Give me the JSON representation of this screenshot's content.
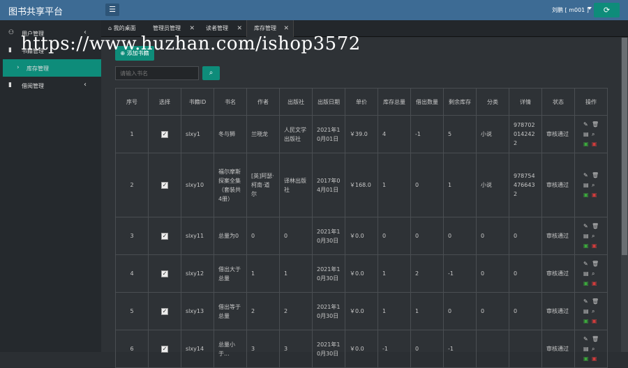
{
  "app": {
    "title": "图书共享平台",
    "user": "刘鹏 [ m001 ]"
  },
  "sidebar": {
    "items": [
      {
        "label": "用户管理",
        "icon": "user-icon"
      },
      {
        "label": "书籍管理",
        "icon": "book-icon"
      },
      {
        "label": "库存管理",
        "icon": "chevron-right-icon"
      },
      {
        "label": "借阅管理",
        "icon": "book-icon"
      }
    ]
  },
  "tabs": [
    {
      "label": "我的桌面"
    },
    {
      "label": "管理员管理"
    },
    {
      "label": "读者管理"
    },
    {
      "label": "库存管理"
    }
  ],
  "toolbar": {
    "add_label": "添加书籍",
    "search_placeholder": "请输入书名"
  },
  "watermark": "https://www.huzhan.com/ishop3572",
  "table": {
    "headers": [
      "序号",
      "选择",
      "书籍ID",
      "书名",
      "作者",
      "出版社",
      "出版日期",
      "单价",
      "库存总量",
      "借出数量",
      "剩余库存",
      "分类",
      "详情",
      "状态",
      "操作"
    ],
    "rows": [
      [
        "1",
        "",
        "slxy1",
        "冬与狮",
        "兰晓龙",
        "人民文学出版社",
        "2021年10月01日",
        "￥39.0",
        "4",
        "-1",
        "5",
        "小说",
        "9787020142422",
        "审核通过"
      ],
      [
        "2",
        "",
        "slxy10",
        "福尔摩斯探案全集（套装共4册）",
        "[英]阿瑟·柯南·道尔",
        "译林出版社",
        "2017年04月01日",
        "￥168.0",
        "1",
        "0",
        "1",
        "小说",
        "9787544766432",
        "审核通过"
      ],
      [
        "3",
        "",
        "slxy11",
        "总量为0",
        "0",
        "0",
        "2021年10月30日",
        "￥0.0",
        "0",
        "0",
        "0",
        "0",
        "0",
        "审核通过"
      ],
      [
        "4",
        "",
        "slxy12",
        "借出大于总量",
        "1",
        "1",
        "2021年10月30日",
        "￥0.0",
        "1",
        "2",
        "-1",
        "0",
        "0",
        "审核通过"
      ],
      [
        "5",
        "",
        "slxy13",
        "借出等于总量",
        "2",
        "2",
        "2021年10月30日",
        "￥0.0",
        "1",
        "1",
        "0",
        "0",
        "0",
        "审核通过"
      ],
      [
        "6",
        "",
        "slxy14",
        "总量小于...",
        "3",
        "3",
        "2021年10月30日",
        "￥0.0",
        "-1",
        "0",
        "-1",
        "",
        "",
        "审核通过"
      ]
    ]
  }
}
